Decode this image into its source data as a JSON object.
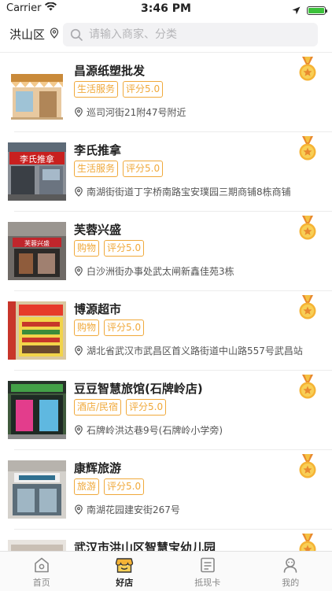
{
  "status": {
    "carrier": "Carrier",
    "time": "3:46 PM"
  },
  "header": {
    "region": "洪山区",
    "search_placeholder": "请输入商家、分类"
  },
  "colors": {
    "accent": "#f0a93b",
    "tag_border": "#f0a93b"
  },
  "stores": [
    {
      "name": "昌源纸塑批发",
      "tags": [
        "生活服务",
        "评分5.0"
      ],
      "address": "巡司河街21附47号附近"
    },
    {
      "name": "李氏推拿",
      "tags": [
        "生活服务",
        "评分5.0"
      ],
      "address": "南湖街街道丁字桥南路宝安璞园三期商铺8栋商铺"
    },
    {
      "name": "芙蓉兴盛",
      "tags": [
        "购物",
        "评分5.0"
      ],
      "address": "白沙洲街办事处武太闸新鑫佳苑3栋"
    },
    {
      "name": "博源超市",
      "tags": [
        "购物",
        "评分5.0"
      ],
      "address": "湖北省武汉市武昌区首义路街道中山路557号武昌站"
    },
    {
      "name": "豆豆智慧旅馆(石牌岭店)",
      "tags": [
        "酒店/民宿",
        "评分5.0"
      ],
      "address": "石牌岭洪达巷9号(石牌岭小学旁)"
    },
    {
      "name": "康辉旅游",
      "tags": [
        "旅游",
        "评分5.0"
      ],
      "address": "南湖花园建安街267号"
    },
    {
      "name": "武汉市洪山区智慧宝幼儿园",
      "tags": [],
      "address": ""
    }
  ],
  "tabbar": {
    "items": [
      "首页",
      "好店",
      "抵现卡",
      "我的"
    ],
    "active": "好店"
  }
}
